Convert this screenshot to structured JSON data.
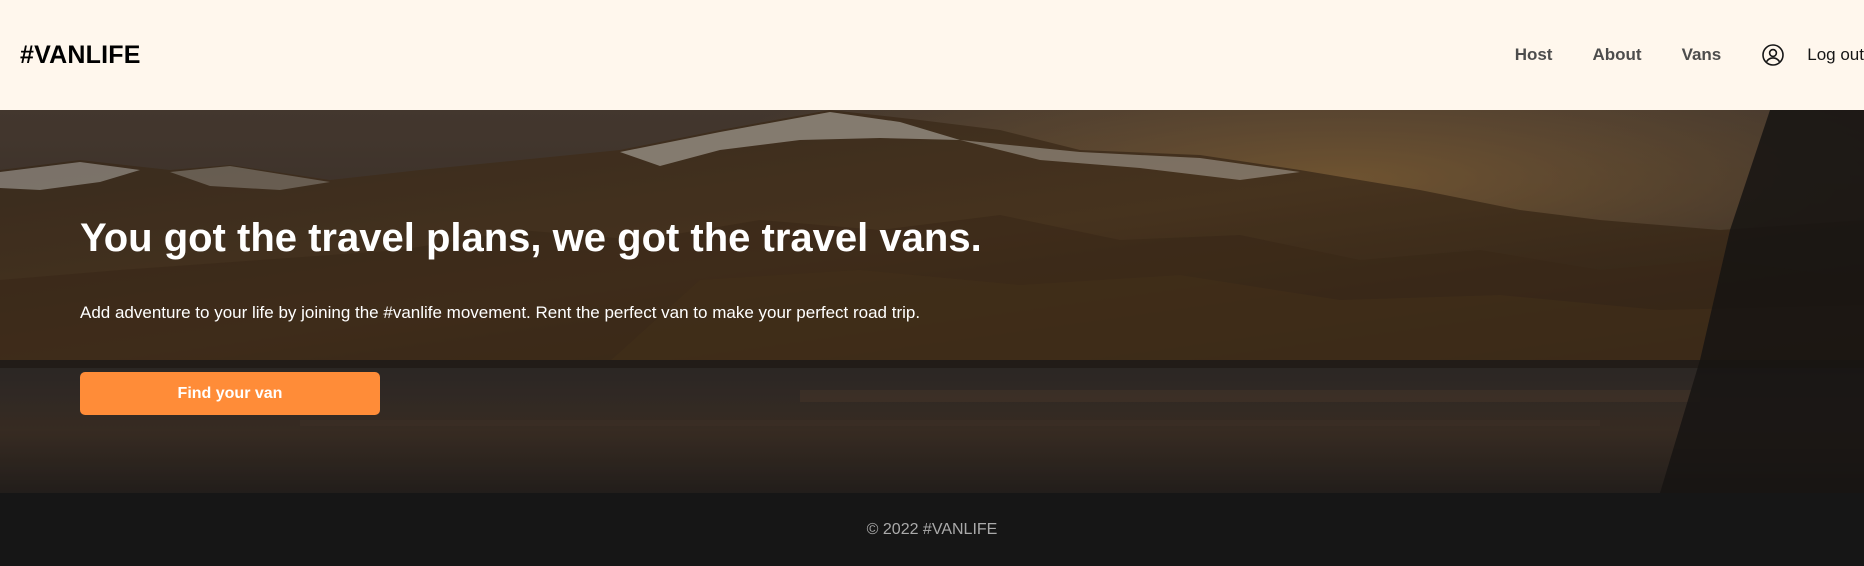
{
  "header": {
    "logo": "#VANLIFE",
    "nav": {
      "host": "Host",
      "about": "About",
      "vans": "Vans",
      "login_icon": "user-circle-icon",
      "logout": "Log out"
    }
  },
  "hero": {
    "title": "You got the travel plans, we got the travel vans.",
    "text": "Add adventure to your life by joining the #vanlife movement. Rent the perfect van to make your perfect road trip.",
    "button_label": "Find your van"
  },
  "footer": {
    "text": "© 2022 #VANLIFE"
  },
  "colors": {
    "header_bg": "#fff7ed",
    "accent": "#ff8c38",
    "footer_bg": "#161616"
  }
}
